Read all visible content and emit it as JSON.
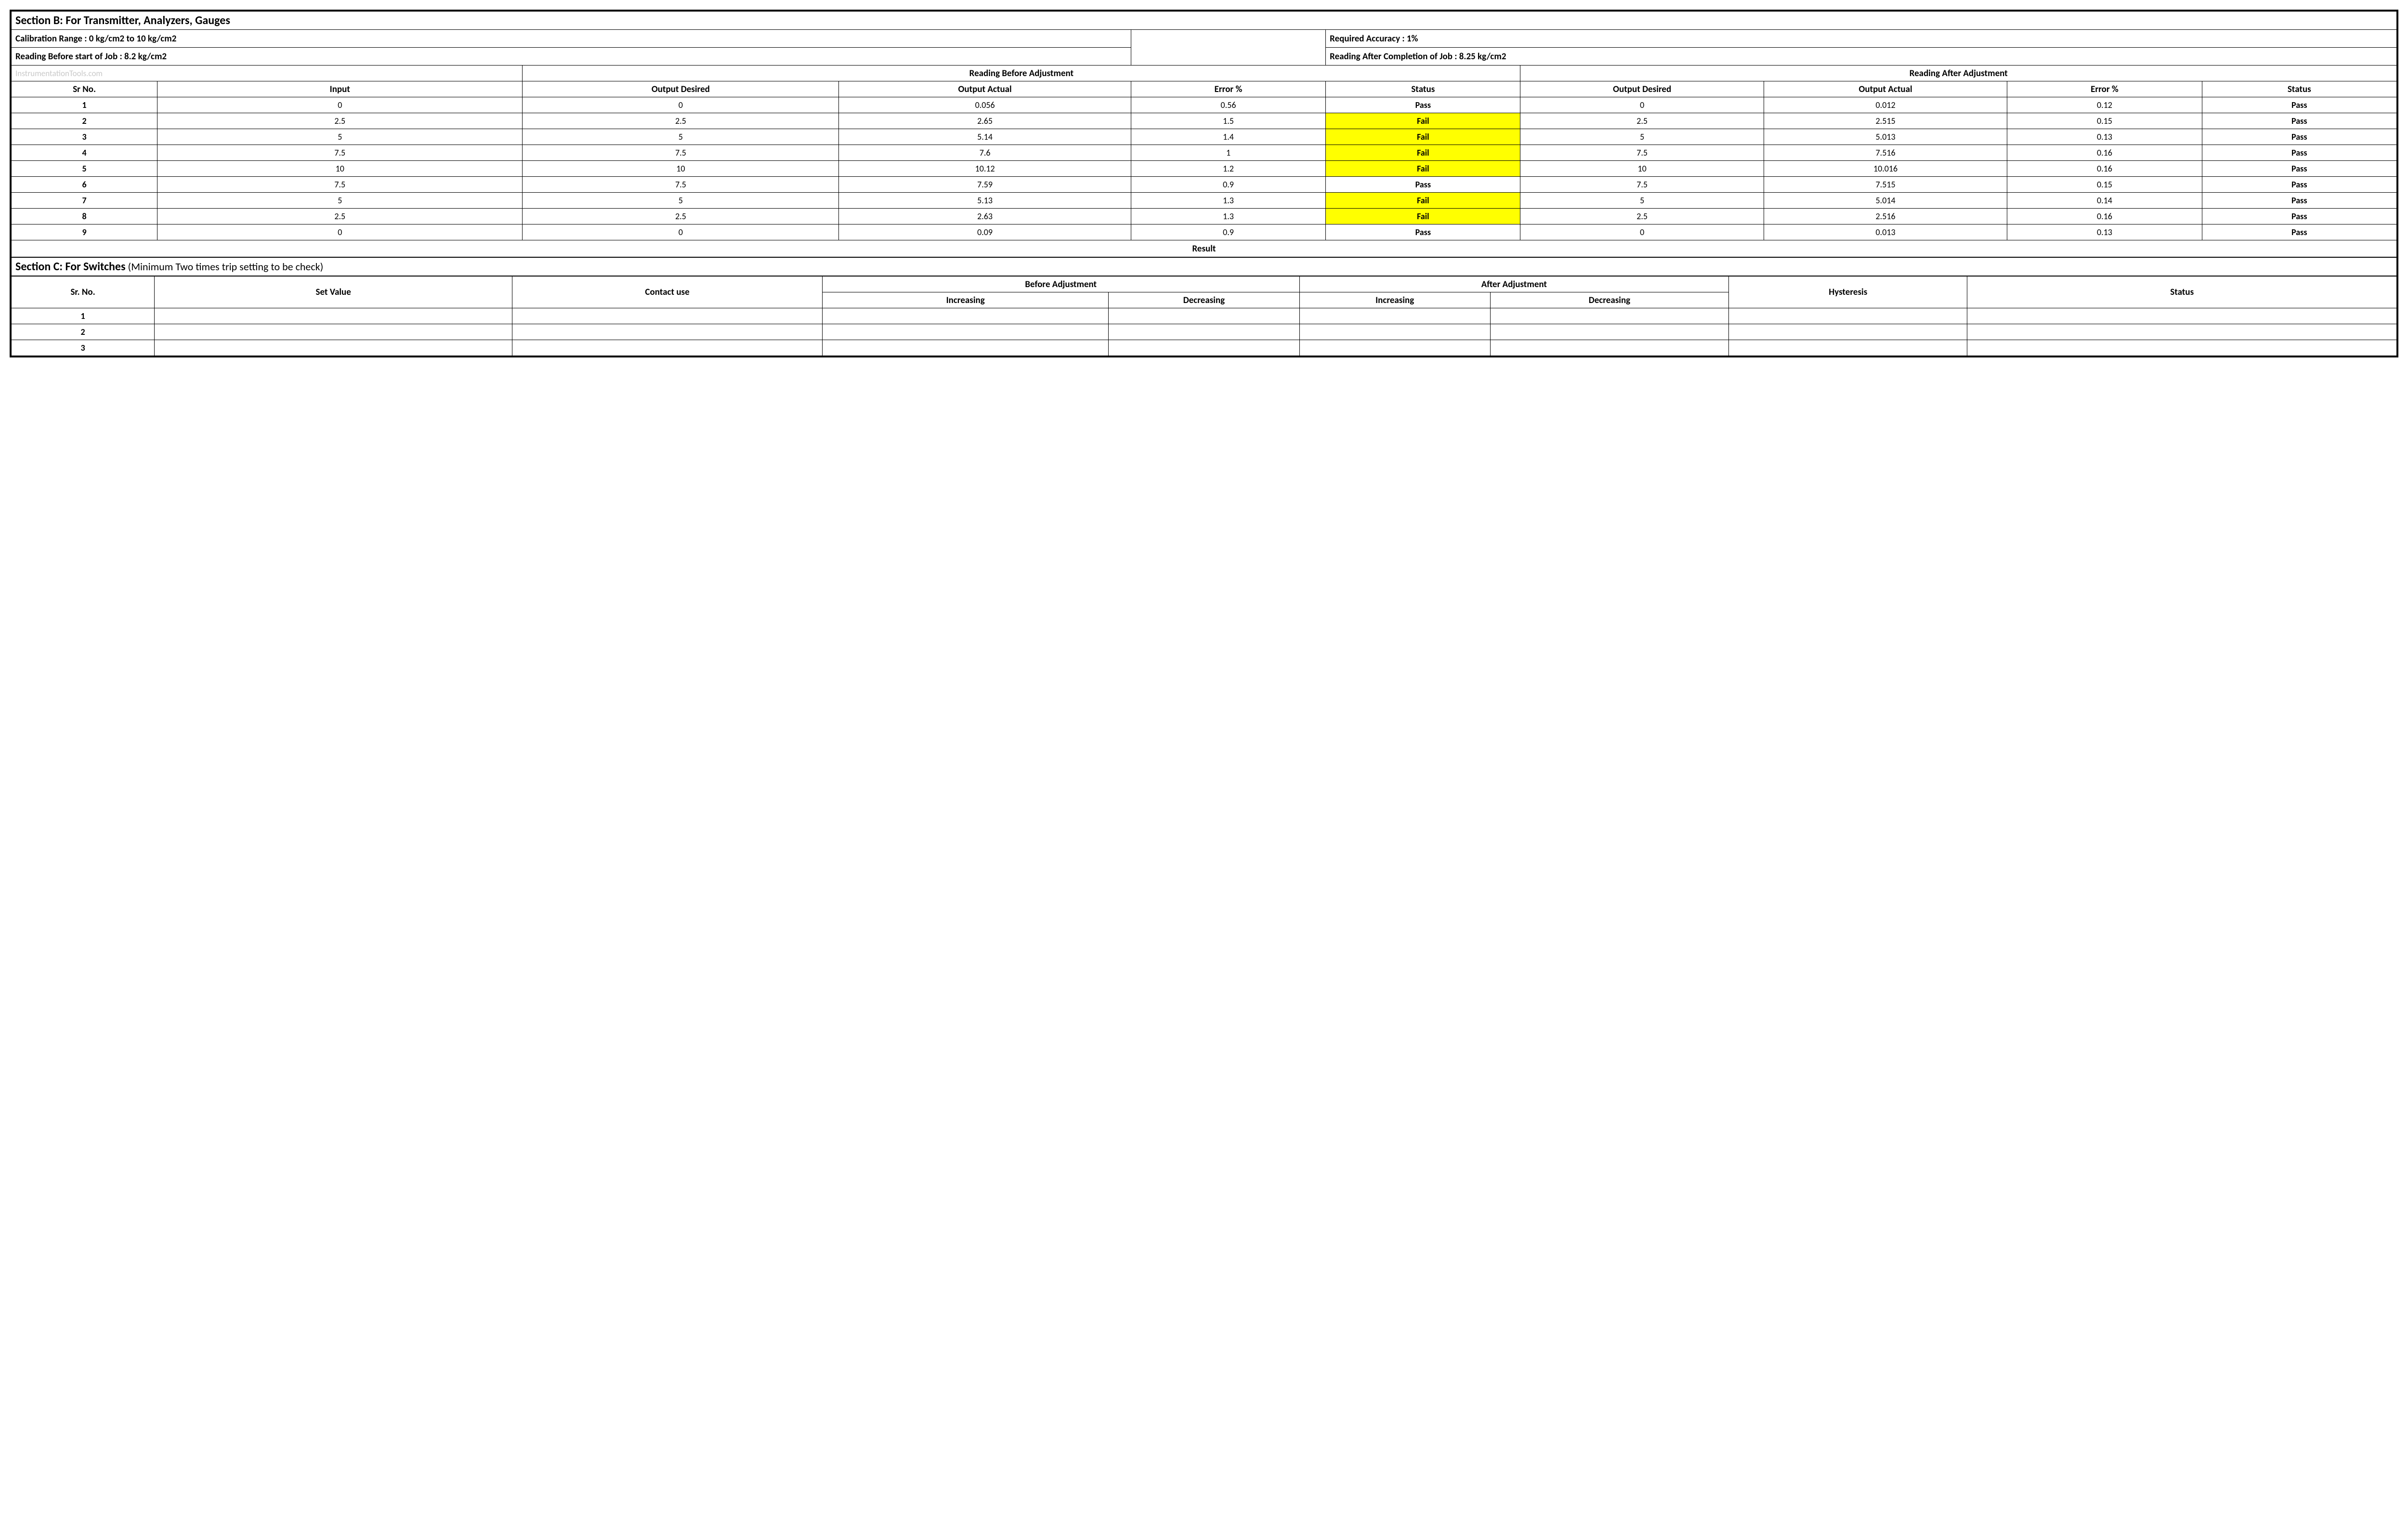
{
  "sectionB": {
    "title": "Section B:  For Transmitter, Analyzers, Gauges",
    "calibRange": "Calibration Range : 0 kg/cm2 to 10 kg/cm2",
    "reqAccuracy": "Required Accuracy : 1%",
    "readingBefore": "Reading Before start of Job : 8.2 kg/cm2",
    "readingAfter": "Reading After Completion of Job : 8.25 kg/cm2",
    "watermark": "InstrumentationTools.com",
    "hdr_before": "Reading Before Adjustment",
    "hdr_after": "Reading After Adjustment",
    "cols": {
      "sr": "Sr No.",
      "input": "Input",
      "outDes": "Output Desired",
      "outAct": "Output Actual",
      "err": "Error %",
      "status": "Status"
    },
    "rows": [
      {
        "sr": "1",
        "input": "0",
        "bDes": "0",
        "bAct": "0.056",
        "bErr": "0.56",
        "bStat": "Pass",
        "aDes": "0",
        "aAct": "0.012",
        "aErr": "0.12",
        "aStat": "Pass"
      },
      {
        "sr": "2",
        "input": "2.5",
        "bDes": "2.5",
        "bAct": "2.65",
        "bErr": "1.5",
        "bStat": "Fail",
        "aDes": "2.5",
        "aAct": "2.515",
        "aErr": "0.15",
        "aStat": "Pass"
      },
      {
        "sr": "3",
        "input": "5",
        "bDes": "5",
        "bAct": "5.14",
        "bErr": "1.4",
        "bStat": "Fail",
        "aDes": "5",
        "aAct": "5.013",
        "aErr": "0.13",
        "aStat": "Pass"
      },
      {
        "sr": "4",
        "input": "7.5",
        "bDes": "7.5",
        "bAct": "7.6",
        "bErr": "1",
        "bStat": "Fail",
        "aDes": "7.5",
        "aAct": "7.516",
        "aErr": "0.16",
        "aStat": "Pass"
      },
      {
        "sr": "5",
        "input": "10",
        "bDes": "10",
        "bAct": "10.12",
        "bErr": "1.2",
        "bStat": "Fail",
        "aDes": "10",
        "aAct": "10.016",
        "aErr": "0.16",
        "aStat": "Pass"
      },
      {
        "sr": "6",
        "input": "7.5",
        "bDes": "7.5",
        "bAct": "7.59",
        "bErr": "0.9",
        "bStat": "Pass",
        "aDes": "7.5",
        "aAct": "7.515",
        "aErr": "0.15",
        "aStat": "Pass"
      },
      {
        "sr": "7",
        "input": "5",
        "bDes": "5",
        "bAct": "5.13",
        "bErr": "1.3",
        "bStat": "Fail",
        "aDes": "5",
        "aAct": "5.014",
        "aErr": "0.14",
        "aStat": "Pass"
      },
      {
        "sr": "8",
        "input": "2.5",
        "bDes": "2.5",
        "bAct": "2.63",
        "bErr": "1.3",
        "bStat": "Fail",
        "aDes": "2.5",
        "aAct": "2.516",
        "aErr": "0.16",
        "aStat": "Pass"
      },
      {
        "sr": "9",
        "input": "0",
        "bDes": "0",
        "bAct": "0.09",
        "bErr": "0.9",
        "bStat": "Pass",
        "aDes": "0",
        "aAct": "0.013",
        "aErr": "0.13",
        "aStat": "Pass"
      }
    ],
    "result": "Result"
  },
  "sectionC": {
    "title": "Section C:  For Switches",
    "note": "  (Minimum Two times trip setting to be check)",
    "cols": {
      "sr": "Sr. No.",
      "setVal": "Set Value",
      "contact": "Contact use",
      "beforeAdj": "Before Adjustment",
      "afterAdj": "After Adjustment",
      "inc": "Increasing",
      "dec": "Decreasing",
      "hyst": "Hysteresis",
      "status": "Status"
    },
    "rows": [
      {
        "sr": "1"
      },
      {
        "sr": "2"
      },
      {
        "sr": "3"
      }
    ]
  },
  "chart_data": {
    "type": "table",
    "title": "Reading Before / After Adjustment",
    "columns": [
      "Sr No.",
      "Input",
      "Output Desired (Before)",
      "Output Actual (Before)",
      "Error % (Before)",
      "Status (Before)",
      "Output Desired (After)",
      "Output Actual (After)",
      "Error % (After)",
      "Status (After)"
    ],
    "rows": [
      [
        1,
        0,
        0,
        0.056,
        0.56,
        "Pass",
        0,
        0.012,
        0.12,
        "Pass"
      ],
      [
        2,
        2.5,
        2.5,
        2.65,
        1.5,
        "Fail",
        2.5,
        2.515,
        0.15,
        "Pass"
      ],
      [
        3,
        5,
        5,
        5.14,
        1.4,
        "Fail",
        5,
        5.013,
        0.13,
        "Pass"
      ],
      [
        4,
        7.5,
        7.5,
        7.6,
        1,
        "Fail",
        7.5,
        7.516,
        0.16,
        "Pass"
      ],
      [
        5,
        10,
        10,
        10.12,
        1.2,
        "Fail",
        10,
        10.016,
        0.16,
        "Pass"
      ],
      [
        6,
        7.5,
        7.5,
        7.59,
        0.9,
        "Pass",
        7.5,
        7.515,
        0.15,
        "Pass"
      ],
      [
        7,
        5,
        5,
        5.13,
        1.3,
        "Fail",
        5,
        5.014,
        0.14,
        "Pass"
      ],
      [
        8,
        2.5,
        2.5,
        2.63,
        1.3,
        "Fail",
        2.5,
        2.516,
        0.16,
        "Pass"
      ],
      [
        9,
        0,
        0,
        0.09,
        0.9,
        "Pass",
        0,
        0.013,
        0.13,
        "Pass"
      ]
    ]
  }
}
